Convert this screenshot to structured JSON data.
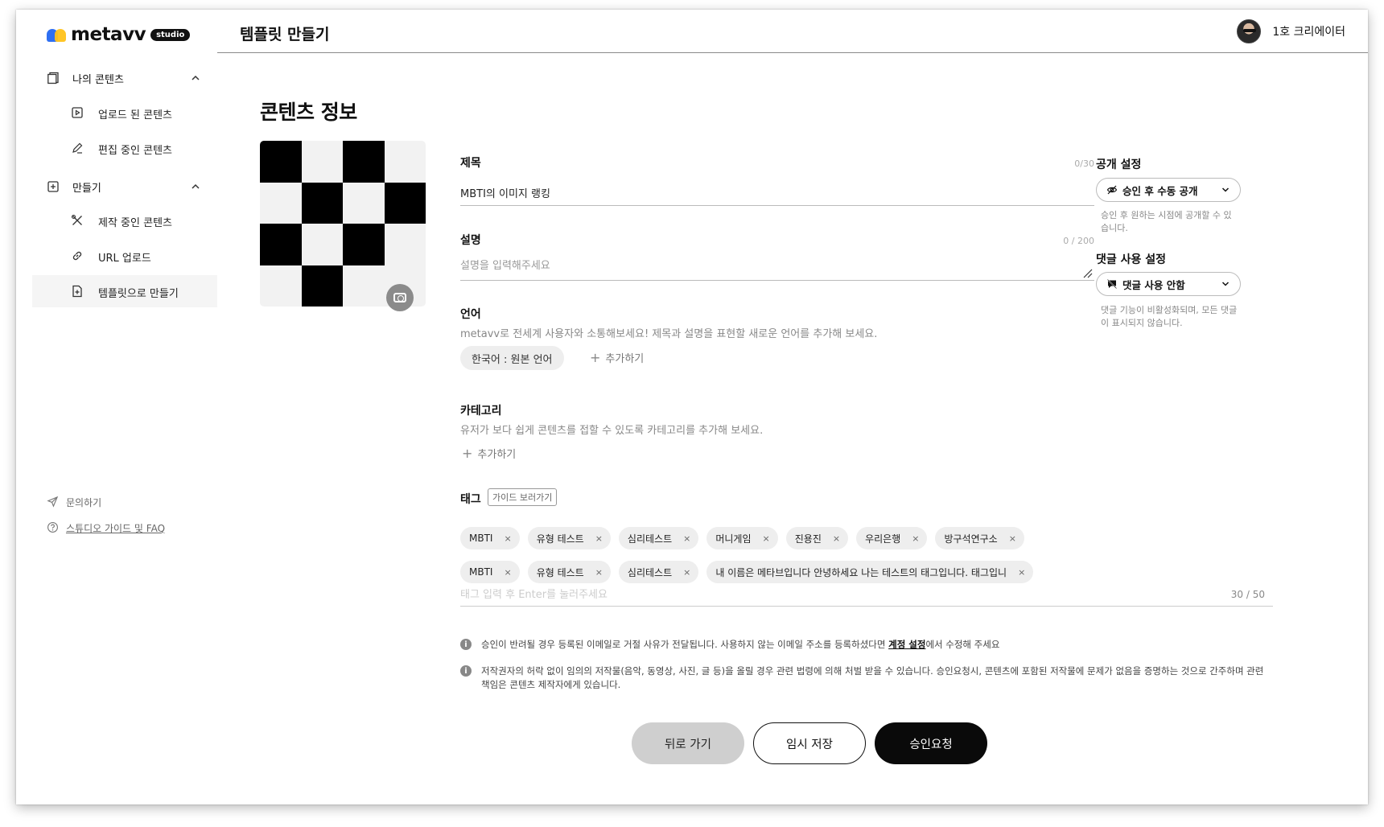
{
  "brand": {
    "name": "metavv",
    "badge": "studio"
  },
  "header": {
    "title": "템플릿 만들기",
    "user_name": "1호 크리에이터"
  },
  "sidebar": {
    "groups": [
      {
        "label": "나의 콘텐츠",
        "items": [
          {
            "label": "업로드 된 콘텐츠"
          },
          {
            "label": "편집 중인 콘텐츠"
          }
        ]
      },
      {
        "label": "만들기",
        "items": [
          {
            "label": "제작 중인 콘텐츠"
          },
          {
            "label": "URL 업로드"
          },
          {
            "label": "템플릿으로 만들기"
          }
        ]
      }
    ],
    "footer": {
      "contact": "문의하기",
      "guide": "스튜디오 가이드 및 FAQ"
    }
  },
  "main": {
    "section_title": "콘텐츠 정보",
    "title_field": {
      "label": "제목",
      "counter": "0/30",
      "value": "MBTI의 이미지 랭킹"
    },
    "desc_field": {
      "label": "설명",
      "counter": "0 / 200",
      "placeholder": "설명을 입력해주세요"
    },
    "language": {
      "label": "언어",
      "helper": "metavv로 전세계 사용자와 소통해보세요! 제목과 설명을 표현할 새로운 언어를 추가해 보세요.",
      "chip": "한국어 : 원본 언어",
      "add": "추가하기"
    },
    "category": {
      "label": "카테고리",
      "helper": "유저가 보다 쉽게 콘텐츠를 접할 수 있도록 카테고리를 추가해 보세요.",
      "add": "추가하기"
    },
    "tags": {
      "label": "태그",
      "guide_button": "가이드 보러가기",
      "row1": [
        "MBTI",
        "유형 테스트",
        "심리테스트",
        "머니게임",
        "진용진",
        "우리은행",
        "방구석연구소"
      ],
      "row2": [
        "MBTI",
        "유형 테스트",
        "심리테스트",
        "내 이름은 메타브입니다 안녕하세요 나는 테스트의 태그입니다. 태그입니"
      ],
      "remove_symbol": "×",
      "input_placeholder": "태그 입력 후 Enter를 눌러주세요",
      "counter": "30 / 50"
    },
    "notices": {
      "n1_before": "승인이 반려될 경우 등록된 이메일로 거절 사유가 전달됩니다. 사용하지 않는 이메일 주소를 등록하셨다면 ",
      "n1_link": "계정 설정",
      "n1_after": "에서 수정해 주세요",
      "n2": "저작권자의 허락 없이 임의의 저작물(음악, 동영상, 사진, 글 등)을 올릴 경우 관련 법령에 의해 처벌 받을 수 있습니다. 승인요청시, 콘텐츠에 포함된 저작물에 문제가 없음을 증명하는 것으로 간주하며 관련 책임은 콘텐츠 제작자에게 있습니다."
    }
  },
  "settings": {
    "visibility": {
      "title": "공개 설정",
      "value": "승인 후 수동 공개",
      "help": "승인 후 원하는 시점에 공개할 수 있습니다."
    },
    "comments": {
      "title": "댓글 사용 설정",
      "value": "댓글 사용 안함",
      "help": "댓글 기능이 비활성화되며, 모든 댓글이 표시되지 않습니다."
    }
  },
  "actions": {
    "back": "뒤로 가기",
    "save": "임시 저장",
    "request": "승인요청"
  },
  "colors": {
    "primary": "#0a0a0a",
    "back_button": "#cfcfcf",
    "chip_bg": "#eeeeee",
    "logo_blue": "#2e6ff2",
    "logo_yellow": "#ffc21a"
  }
}
